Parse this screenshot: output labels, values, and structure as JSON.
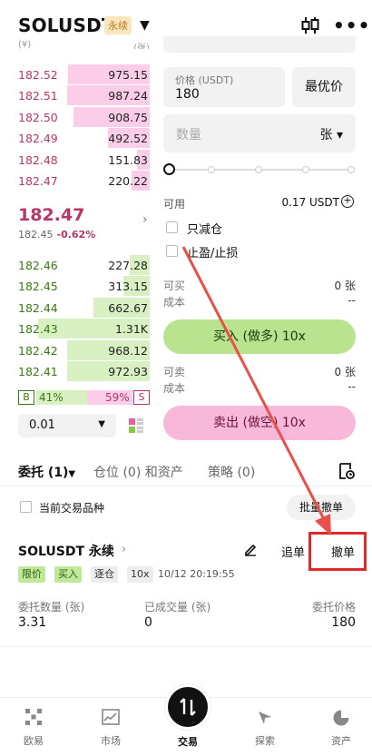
{
  "header": {
    "symbol": "SOLUSDT",
    "tag": "永续"
  },
  "orderbook": {
    "asks": [
      {
        "price": "182.52",
        "qty": "975.15",
        "depth": 0.62
      },
      {
        "price": "182.51",
        "qty": "987.24",
        "depth": 0.63
      },
      {
        "price": "182.50",
        "qty": "908.75",
        "depth": 0.58
      },
      {
        "price": "182.49",
        "qty": "492.52",
        "depth": 0.32
      },
      {
        "price": "182.48",
        "qty": "151.83",
        "depth": 0.1
      },
      {
        "price": "182.47",
        "qty": "220.22",
        "depth": 0.14
      }
    ],
    "last_price": "182.47",
    "mark_price": "182.45",
    "change": "-0.62%",
    "bids": [
      {
        "price": "182.46",
        "qty": "227.28",
        "depth": 0.15
      },
      {
        "price": "182.45",
        "qty": "313.15",
        "depth": 0.2
      },
      {
        "price": "182.44",
        "qty": "662.67",
        "depth": 0.43
      },
      {
        "price": "182.43",
        "qty": "1.31K",
        "depth": 0.85
      },
      {
        "price": "182.42",
        "qty": "968.12",
        "depth": 0.63
      },
      {
        "price": "182.41",
        "qty": "972.93",
        "depth": 0.63
      }
    ],
    "buy_letter": "B",
    "buy_pct": "41%",
    "sell_pct": "59%",
    "sell_letter": "S",
    "precision": "0.01"
  },
  "form": {
    "price_label": "价格 (USDT)",
    "price_value": "180",
    "best_price": "最优价",
    "qty_placeholder": "数量",
    "qty_unit": "张",
    "available_label": "可用",
    "available_value": "0.17 USDT",
    "reduce_only": "只减仓",
    "tp_sl": "止盈/止损",
    "can_buy_label": "可买",
    "can_buy_value": "0 张",
    "cost_label": "成本",
    "cost_value": "--",
    "buy_button": "买入 (做多) 10x",
    "can_sell_label": "可卖",
    "can_sell_value": "0 张",
    "cost2_label": "成本",
    "cost2_value": "--",
    "sell_button": "卖出 (做空) 10x"
  },
  "tabs": {
    "orders": "委托 (1)",
    "positions": "仓位 (0) 和资产",
    "strategy": "策略 (0)"
  },
  "filter": {
    "current_only": "当前交易品种",
    "cancel_all": "批量撤单"
  },
  "order": {
    "title": "SOLUSDT 永续",
    "chase": "追单",
    "cancel": "撤单",
    "tags": [
      "限价",
      "买入",
      "逐仓",
      "10x"
    ],
    "time": "10/12 20:19:55",
    "qty_label": "委托数量 (张)",
    "qty_value": "3.31",
    "filled_label": "已成交量 (张)",
    "filled_value": "0",
    "price_label": "委托价格",
    "price_value": "180"
  },
  "nav": {
    "items": [
      "欧易",
      "市场",
      "交易",
      "探索",
      "资产"
    ]
  }
}
